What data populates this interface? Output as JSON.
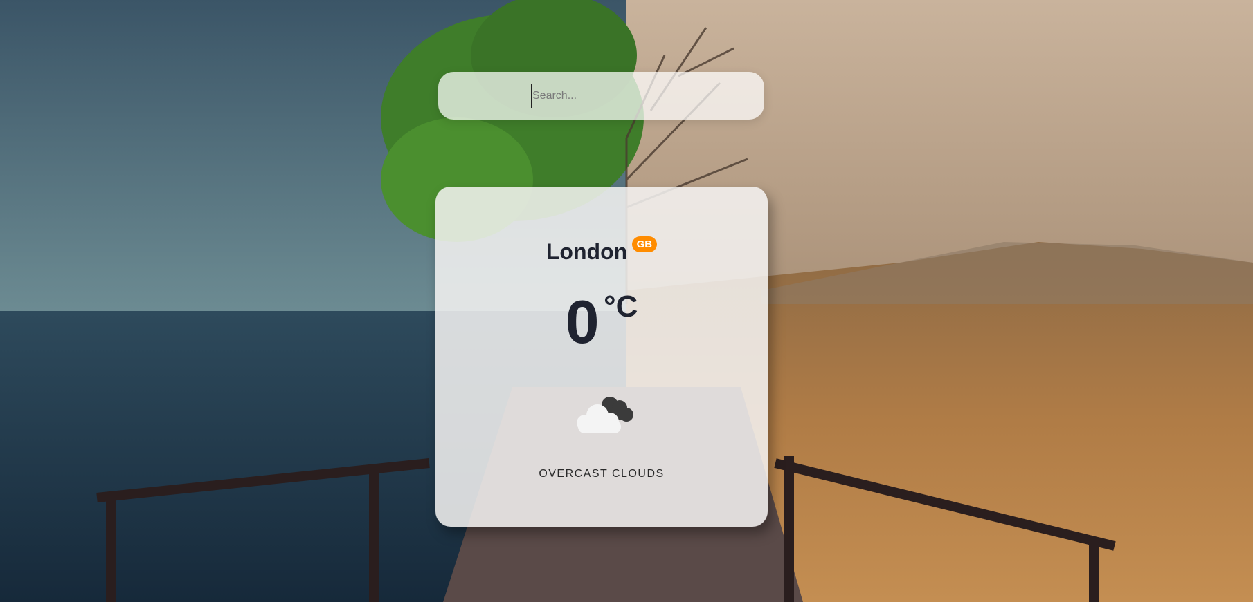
{
  "search": {
    "placeholder": "Search..."
  },
  "weather": {
    "city": "London",
    "country": "GB",
    "temperature": "0",
    "unit": "°C",
    "description": "OVERCAST CLOUDS",
    "icon": "overcast-clouds-icon"
  },
  "colors": {
    "badge": "#ff8c00",
    "text": "#1f2330"
  }
}
